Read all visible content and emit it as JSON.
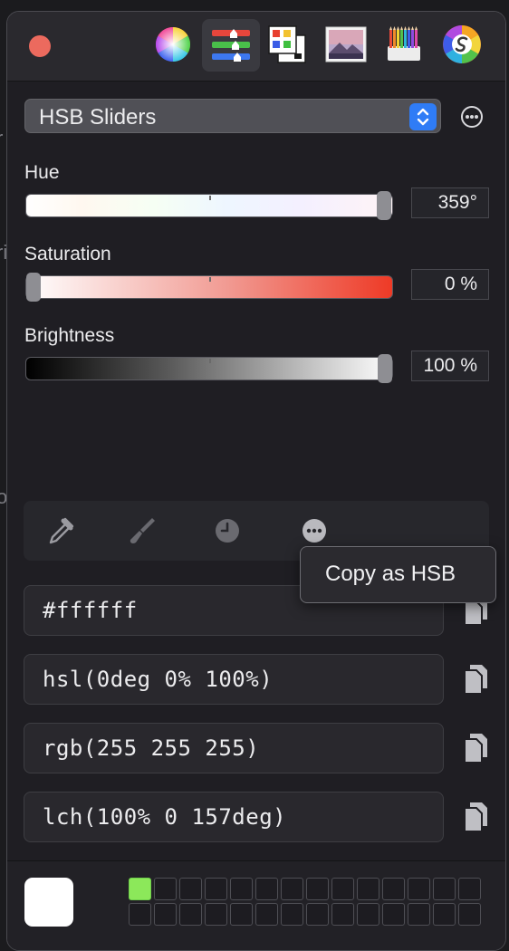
{
  "toolbar": {
    "icons": [
      "color-wheel-icon",
      "sliders-icon",
      "palettes-icon",
      "image-icon",
      "pencils-icon",
      "spectrum-icon"
    ],
    "active_icon": "sliders-icon"
  },
  "mode_select": {
    "selected": "HSB Sliders"
  },
  "sliders": {
    "hue": {
      "label": "Hue",
      "value_text": "359°",
      "value": 359,
      "max": 360
    },
    "saturation": {
      "label": "Saturation",
      "value_text": "0 %",
      "value": 0,
      "max": 100
    },
    "brightness": {
      "label": "Brightness",
      "value_text": "100 %",
      "value": 100,
      "max": 100
    }
  },
  "tools": [
    "eyedropper-icon",
    "brush-icon",
    "history-clock-icon",
    "more-icon"
  ],
  "popover": {
    "item": "Copy as HSB"
  },
  "codes": {
    "hex": "#ffffff",
    "hsl": "hsl(0deg 0% 100%)",
    "rgb": "rgb(255 255 255)",
    "lch": "lch(100% 0 157deg)"
  },
  "current_color": "#ffffff",
  "swatches": {
    "first_color": "#8ce85a",
    "count": 28
  },
  "colors": {
    "accent": "#2f7cf6",
    "close": "#ec6a5e",
    "saturation_end": "#ee3a26"
  }
}
